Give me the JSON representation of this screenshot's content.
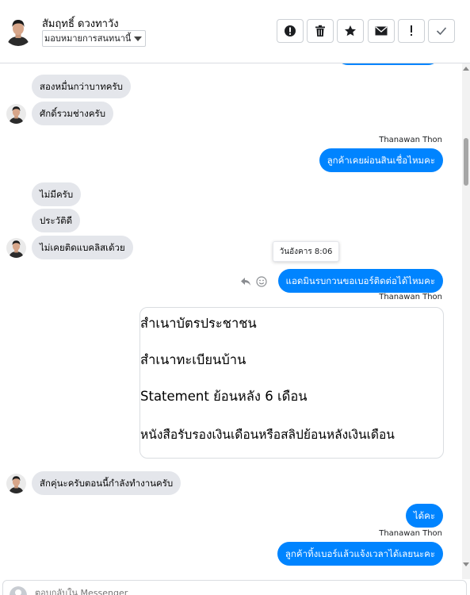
{
  "header": {
    "contact_name": "สัมฤทธิ์ ดวงทาวัง",
    "assign_label": "มอบหมายการสนทนานี้",
    "actions": [
      {
        "icon": "exclamation-circle-icon"
      },
      {
        "icon": "trash-icon"
      },
      {
        "icon": "star-icon"
      },
      {
        "icon": "envelope-icon"
      },
      {
        "icon": "exclamation-icon"
      },
      {
        "icon": "check-icon"
      }
    ]
  },
  "messages": [
    {
      "side": "in",
      "text": "สองหมื่นกว่าบาทครับ"
    },
    {
      "side": "in",
      "text": "ศักดิ์รวมช่างครับ",
      "avatar": true
    },
    {
      "side": "out",
      "sender": "Thanawan Thon",
      "text": "ลูกค้าเคยผ่อนสินเชื่อไหมคะ"
    },
    {
      "side": "in",
      "text": "ไม่มีครับ"
    },
    {
      "side": "in",
      "text": "ประวัติดี"
    },
    {
      "side": "in",
      "text": "ไม่เคยติดแบคลิสเด้วย",
      "avatar": true
    },
    {
      "side": "out",
      "text": "แอดมินรบกวนขอเบอร์ติดต่อได้ไหมคะ",
      "tooltip": "วันอังคาร 8:06"
    },
    {
      "side": "out",
      "sender": "Thanawan Thon",
      "type": "document",
      "lines": [
        "สำเนาบัตรประชาชน",
        "สำเนาทะเบียนบ้าน",
        "Statement ย้อนหลัง 6 เดือน",
        "หนังสือรับรองเงินเดือนหรือสลิปย้อนหลังเงินเดือน"
      ]
    },
    {
      "side": "in",
      "text": "สักคุ่นะครับตอนนี้กำลังทำงานครับ",
      "avatar": true
    },
    {
      "side": "out",
      "text": "ได้คะ"
    },
    {
      "side": "out",
      "sender": "Thanawan Thon",
      "text": "ลูกค้าทิ้งเบอร์แล้วแจ้งเวลาได้เลยนะคะ"
    }
  ],
  "composer": {
    "placeholder": "ตอบกลับใน Messenger"
  },
  "colors": {
    "outgoing_bubble": "#0084ff",
    "incoming_bubble": "#e4e6eb"
  }
}
